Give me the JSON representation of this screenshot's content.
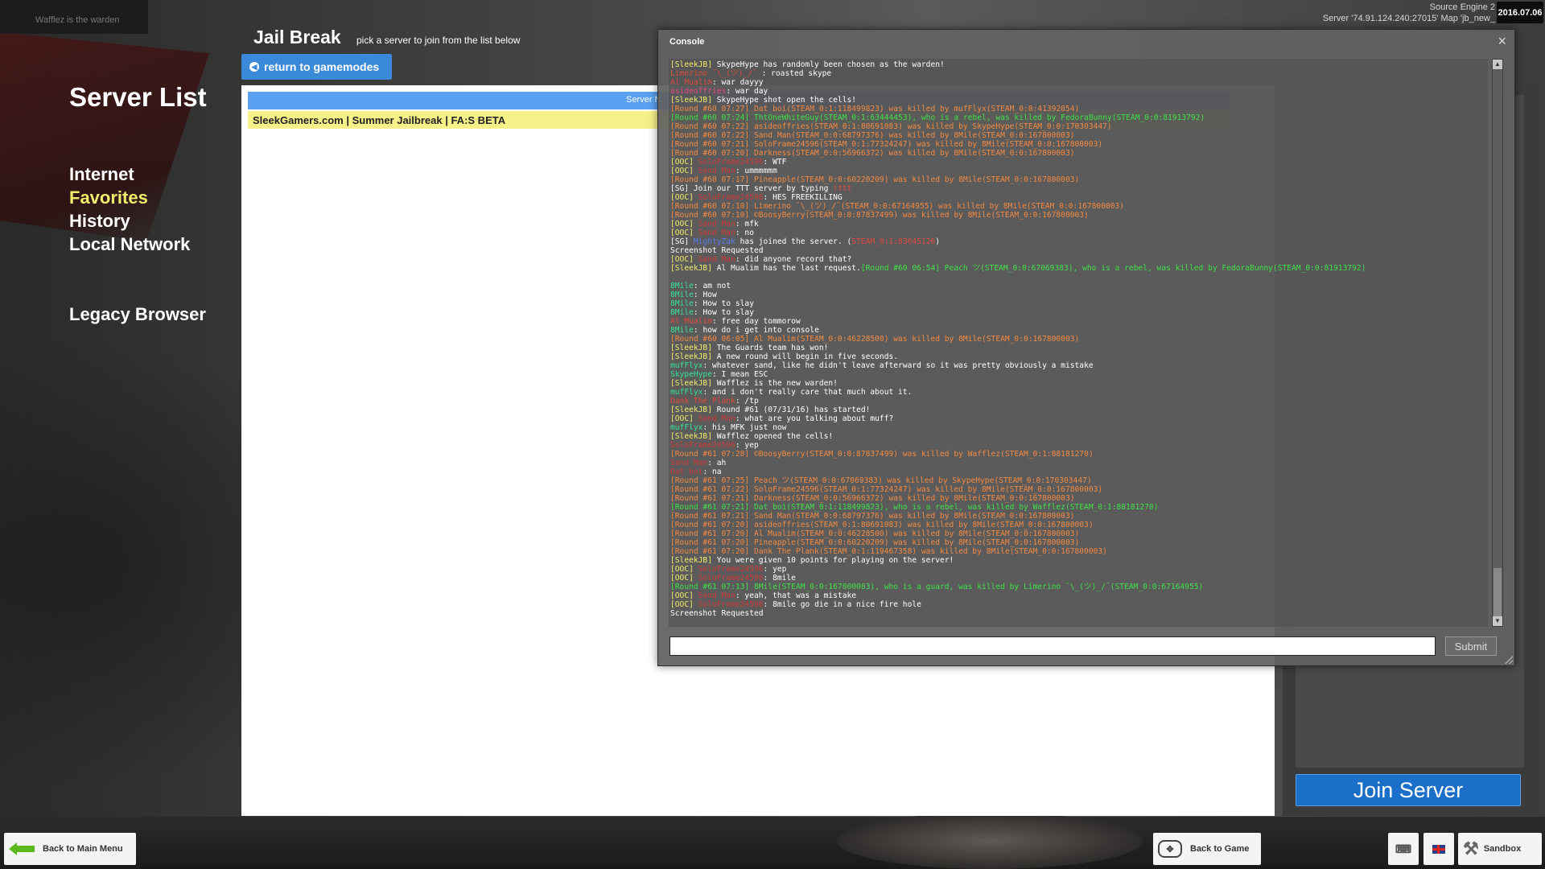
{
  "window": {
    "notice": "Wafflez is the warden",
    "engine_line": "Source Engine 2",
    "server_line": "Server '74.91.124.240:27015' Map 'jb_new_",
    "date": "2016.07.06"
  },
  "nav": {
    "title": "Server List",
    "items": [
      "Internet",
      "Favorites",
      "History",
      "Local Network"
    ],
    "active": "Favorites",
    "legacy": "Legacy Browser"
  },
  "gamemode": {
    "title": "Jail Break",
    "subtitle": "pick a server to join from the list below",
    "return_label": "return to gamemodes",
    "column_header": "Server N",
    "servers": [
      "SleekGamers.com | Summer Jailbreak | FA:S BETA"
    ]
  },
  "join_label": "Join Server",
  "console": {
    "title": "Console",
    "close_symbol": "×",
    "submit_label": "Submit",
    "lines": [
      [
        [
          "y",
          "[SleekJB] "
        ],
        [
          "w",
          "SkypeHype has randomly been chosen as the warden!"
        ]
      ],
      [
        [
          "r",
          "Limerino ¯\\_(ツ)_/¯"
        ],
        [
          "w",
          " : roasted skype"
        ]
      ],
      [
        [
          "r",
          "Al Mualim"
        ],
        [
          "w",
          ": war dayyy"
        ]
      ],
      [
        [
          "p",
          "asideoffries"
        ],
        [
          "w",
          ": war day"
        ]
      ],
      [
        [
          "y",
          "[SleekJB] "
        ],
        [
          "w",
          "SkypeHype shot open the cells!"
        ]
      ],
      [
        [
          "o",
          "[Round #60 07:27] Dat boi(STEAM_0:1:118499823) was killed by mufFlyx(STEAM_0:0:41392054)"
        ]
      ],
      [
        [
          "g",
          "[Round #60 07:24] ThtOneWhiteGuy(STEAM_0:1:63444453), who is a rebel, was killed by FedoraBunny(STEAM_0:0:81913792)"
        ]
      ],
      [
        [
          "o",
          "[Round #60 07:22] asideoffries(STEAM_0:1:80691083) was killed by SkypeHype(STEAM_0:0:170303447)"
        ]
      ],
      [
        [
          "o",
          "[Round #60 07:22] Sand Man(STEAM_0:0:68797376) was killed by 8Mile(STEAM_0:0:167800003)"
        ]
      ],
      [
        [
          "o",
          "[Round #60 07:21] SoloFrame24596(STEAM_0:1:77324247) was killed by 8Mile(STEAM_0:0:167800003)"
        ]
      ],
      [
        [
          "o",
          "[Round #60 07:20] Darkness(STEAM_0:0:56966372) was killed by 8Mile(STEAM_0:0:167800003)"
        ]
      ],
      [
        [
          "y",
          "[OOC] "
        ],
        [
          "d",
          "SoloFrame24596"
        ],
        [
          "w",
          ": WTF"
        ]
      ],
      [
        [
          "y",
          "[OOC] "
        ],
        [
          "d",
          "Sand Man"
        ],
        [
          "w",
          ": ummmmmm"
        ]
      ],
      [
        [
          "o",
          "[Round #60 07:17] Pineapple(STEAM_0:0:60220209) was killed by 8Mile(STEAM_0:0:167800003)"
        ]
      ],
      [
        [
          "w",
          "[SG] Join our TTT server by typing "
        ],
        [
          "r",
          "!ttt"
        ]
      ],
      [
        [
          "y",
          "[OOC] "
        ],
        [
          "d",
          "SoloFrame24596"
        ],
        [
          "w",
          ": HES FREEKILLING"
        ]
      ],
      [
        [
          "o",
          "[Round #60 07:10] Limerino ¯\\_(ツ)_/¯(STEAM_0:0:67164955) was killed by 8Mile(STEAM_0:0:167800003)"
        ]
      ],
      [
        [
          "o",
          "[Round #60 07:10] ©BoosyBerry(STEAM_0:0:87837499) was killed by 8Mile(STEAM_0:0:167800003)"
        ]
      ],
      [
        [
          "y",
          "[OOC] "
        ],
        [
          "d",
          "Sand Man"
        ],
        [
          "w",
          ": mfk"
        ]
      ],
      [
        [
          "y",
          "[OOC] "
        ],
        [
          "d",
          "Sand Man"
        ],
        [
          "w",
          ": no"
        ]
      ],
      [
        [
          "w",
          "[SG] "
        ],
        [
          "b",
          "MightyZak"
        ],
        [
          "w",
          " has joined the server. ("
        ],
        [
          "r",
          "STEAM_0:1:83645126"
        ],
        [
          "w",
          ")"
        ]
      ],
      [
        [
          "w",
          "Screenshot Requested"
        ]
      ],
      [
        [
          "y",
          "[OOC] "
        ],
        [
          "d",
          "Sand Man"
        ],
        [
          "w",
          ": did anyone record that?"
        ]
      ],
      [
        [
          "y",
          "[SleekJB] "
        ],
        [
          "w",
          "Al Mualim has the last request."
        ],
        [
          "g",
          "[Round #60 06:54] Peach ツ(STEAM_0:0:67069383), who is a rebel, was killed by FedoraBunny(STEAM_0:0:81913792)"
        ]
      ],
      [],
      [
        [
          "c",
          "8Mile"
        ],
        [
          "w",
          ": am not"
        ]
      ],
      [
        [
          "c",
          "8Mile"
        ],
        [
          "w",
          ": How"
        ]
      ],
      [
        [
          "c",
          "8Mile"
        ],
        [
          "w",
          ": How to slay"
        ]
      ],
      [
        [
          "c",
          "8Mile"
        ],
        [
          "w",
          ": How to slay"
        ]
      ],
      [
        [
          "r",
          "Al Mualim"
        ],
        [
          "w",
          ": free day tommorow"
        ]
      ],
      [
        [
          "c",
          "8Mile"
        ],
        [
          "w",
          ": how do i get into console"
        ]
      ],
      [
        [
          "o",
          "[Round #60 06:05] Al Mualim(STEAM_0:0:46228500) was killed by 8Mile(STEAM_0:0:167800003)"
        ]
      ],
      [
        [
          "y",
          "[SleekJB] "
        ],
        [
          "w",
          "The Guards team has won!"
        ]
      ],
      [
        [
          "y",
          "[SleekJB] "
        ],
        [
          "w",
          "A new round will begin in five seconds."
        ]
      ],
      [
        [
          "c",
          "mufFlyx"
        ],
        [
          "w",
          ": whatever sand, like he didn't leave afterward so it was pretty obviously a mistake"
        ]
      ],
      [
        [
          "c",
          "SkypeHype"
        ],
        [
          "w",
          ": I mean ESC"
        ]
      ],
      [
        [
          "y",
          "[SleekJB] "
        ],
        [
          "w",
          "Wafflez is the new warden!"
        ]
      ],
      [
        [
          "c",
          "mufFlyx"
        ],
        [
          "w",
          ": and i don't really care that much about it."
        ]
      ],
      [
        [
          "r",
          "Dank The Plank"
        ],
        [
          "w",
          ": /tp"
        ]
      ],
      [
        [
          "y",
          "[SleekJB] "
        ],
        [
          "w",
          "Round #61 (07/31/16) has started!"
        ]
      ],
      [
        [
          "y",
          "[OOC] "
        ],
        [
          "d",
          "Sand Man"
        ],
        [
          "w",
          ": what are you talking about muff?"
        ]
      ],
      [
        [
          "c",
          "mufFlyx"
        ],
        [
          "w",
          ": his MFK just now"
        ]
      ],
      [
        [
          "y",
          "[SleekJB] "
        ],
        [
          "w",
          "Wafflez opened the cells!"
        ]
      ],
      [
        [
          "d",
          "SoloFrame24596"
        ],
        [
          "w",
          ": yep"
        ]
      ],
      [
        [
          "o",
          "[Round #61 07:28] ©BoosyBerry(STEAM_0:0:87837499) was killed by Wafflez(STEAM_0:1:88181270)"
        ]
      ],
      [
        [
          "d",
          "Sand Man"
        ],
        [
          "w",
          ": ah"
        ]
      ],
      [
        [
          "d",
          "Dat boi"
        ],
        [
          "w",
          ": na"
        ]
      ],
      [
        [
          "o",
          "[Round #61 07:25] Peach ツ(STEAM_0:0:67069383) was killed by SkypeHype(STEAM_0:0:170303447)"
        ]
      ],
      [
        [
          "o",
          "[Round #61 07:22] SoloFrame24596(STEAM_0:1:77324247) was killed by 8Mile(STEAM_0:0:167800003)"
        ]
      ],
      [
        [
          "o",
          "[Round #61 07:21] Darkness(STEAM_0:0:56966372) was killed by 8Mile(STEAM_0:0:167800003)"
        ]
      ],
      [
        [
          "g",
          "[Round #61 07:21] Dat boi(STEAM_0:1:118499823), who is a rebel, was killed by Wafflez(STEAM_0:1:88181270)"
        ]
      ],
      [
        [
          "o",
          "[Round #61 07:21] Sand Man(STEAM_0:0:68797376) was killed by 8Mile(STEAM_0:0:167800003)"
        ]
      ],
      [
        [
          "o",
          "[Round #61 07:20] asideoffries(STEAM_0:1:80691083) was killed by 8Mile(STEAM_0:0:167800003)"
        ]
      ],
      [
        [
          "o",
          "[Round #61 07:20] Al Mualim(STEAM_0:0:46228500) was killed by 8Mile(STEAM_0:0:167800003)"
        ]
      ],
      [
        [
          "o",
          "[Round #61 07:20] Pineapple(STEAM_0:0:60220209) was killed by 8Mile(STEAM_0:0:167800003)"
        ]
      ],
      [
        [
          "o",
          "[Round #61 07:20] Dank The Plank(STEAM_0:1:119467358) was killed by 8Mile(STEAM_0:0:167800003)"
        ]
      ],
      [
        [
          "y",
          "[SleekJB] "
        ],
        [
          "w",
          "You were given 10 points for playing on the server!"
        ]
      ],
      [
        [
          "y",
          "[OOC] "
        ],
        [
          "d",
          "SoloFrame24596"
        ],
        [
          "w",
          ": yep"
        ]
      ],
      [
        [
          "y",
          "[OOC] "
        ],
        [
          "d",
          "SoloFrame24596"
        ],
        [
          "w",
          ": 8mile"
        ]
      ],
      [
        [
          "g",
          "[Round #61 07:13] 8Mile(STEAM_0:0:167800003), who is a guard, was killed by Limerino ¯\\_(ツ)_/¯(STEAM_0:0:67164955)"
        ]
      ],
      [
        [
          "y",
          "[OOC] "
        ],
        [
          "d",
          "Sand Man"
        ],
        [
          "w",
          ": yeah, that was a mistake"
        ]
      ],
      [
        [
          "y",
          "[OOC] "
        ],
        [
          "d",
          "SoloFrame24596"
        ],
        [
          "w",
          ": 8mile go die in a nice fire hole"
        ]
      ],
      [
        [
          "w",
          "Screenshot Requested"
        ]
      ]
    ]
  },
  "bottom": {
    "main_menu": "Back to Main Menu",
    "back_to_game": "Back to Game",
    "sandbox": "Sandbox"
  },
  "icons": {
    "back_arrow": "green-left-arrow-icon",
    "gamepad": "gamepad-icon",
    "controller": "controller-icon",
    "flag": "uk-flag-icon",
    "hammer": "hammer-icon"
  },
  "colors": {
    "accent_blue": "#3a8ad9",
    "join_blue": "#1b6fc9",
    "active_nav": "#f2ec6b",
    "selected_row": "#f7f18a"
  }
}
